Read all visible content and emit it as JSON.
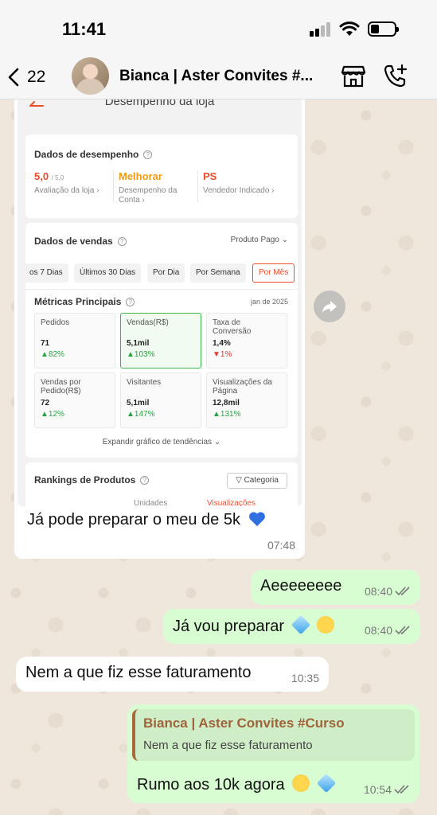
{
  "status_bar": {
    "time": "11:41"
  },
  "header": {
    "back_count": "22",
    "contact_name": "Bianca | Aster Convites #..."
  },
  "screenshot": {
    "title": "Desempenho da loja",
    "performance": {
      "title": "Dados de desempenho",
      "items": [
        {
          "value": "5,0",
          "suffix": "/ 5,0",
          "label": "Avaliação da loja",
          "color": "#ee4d2d"
        },
        {
          "value": "Melhorar",
          "label": "Desempenho da Conta",
          "color": "#f39c12"
        },
        {
          "value": "PS",
          "label": "Vendedor Indicado",
          "color": "#ee4d2d"
        }
      ]
    },
    "sales": {
      "title": "Dados de vendas",
      "dropdown": "Produto Pago",
      "chips": [
        "os 7 Dias",
        "Últimos 30 Dias",
        "Por Dia",
        "Por Semana",
        "Por Mês"
      ],
      "active_chip": "Por Mês",
      "metrics_title": "Métricas Principais",
      "period": "jan de 2025",
      "metrics": [
        {
          "label": "Pedidos",
          "value": "71",
          "change": "82%",
          "dir": "up"
        },
        {
          "label": "Vendas(R$)",
          "value": "5,1mil",
          "change": "103%",
          "dir": "up"
        },
        {
          "label": "Taxa de Conversão",
          "value": "1,4%",
          "change": "1%",
          "dir": "down"
        },
        {
          "label": "Vendas por Pedido(R$)",
          "value": "72",
          "change": "12%",
          "dir": "up"
        },
        {
          "label": "Visitantes",
          "value": "5,1mil",
          "change": "147%",
          "dir": "up"
        },
        {
          "label": "Visualizações da Página",
          "value": "12,8mil",
          "change": "131%",
          "dir": "up"
        }
      ],
      "expand_label": "Expandir gráfico de tendências"
    },
    "rankings": {
      "title": "Rankings de Produtos",
      "filter": "Categoria",
      "col_units": "Unidades",
      "col_views": "Visualizações"
    }
  },
  "messages": [
    {
      "text": "Já pode preparar o meu de 5k",
      "time": "07:48",
      "direction": "in"
    },
    {
      "text": "Aeeeeeeee",
      "time": "08:40",
      "direction": "out"
    },
    {
      "text": "Já vou preparar",
      "time": "08:40",
      "direction": "out"
    },
    {
      "text": "Nem a que fiz esse faturamento",
      "time": "10:35",
      "direction": "in"
    },
    {
      "quote_author": "Bianca | Aster Convites #Curso",
      "quote_text": "Nem a que fiz esse faturamento",
      "text": "Rumo aos 10k agora",
      "time": "10:54",
      "direction": "out"
    }
  ],
  "colors": {
    "accent": "#ee4d2d",
    "warn": "#f39c12",
    "positive": "#26a541",
    "negative": "#e53935",
    "bubble_out": "#d9fdd3",
    "bubble_in": "#ffffff",
    "heart": "#2f6fe0"
  },
  "icons": [
    "back-chevron-icon",
    "store-icon",
    "add-call-icon",
    "forward-icon",
    "double-check-icon",
    "blue-heart-emoji",
    "gem-emoji",
    "star-struck-emoji"
  ]
}
